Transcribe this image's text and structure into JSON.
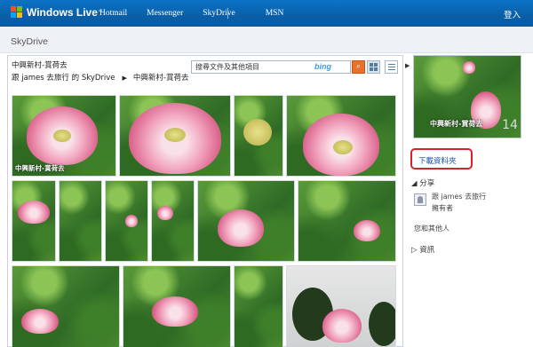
{
  "topbar": {
    "brand": "Windows Live",
    "brand_tm": "™",
    "links": [
      "Hotmail",
      "Messenger",
      "SkyDrive",
      "MSN"
    ],
    "signin": "登入"
  },
  "subheader": {
    "title": "SkyDrive"
  },
  "breadcrumb": {
    "folder": "中興新村-賞荷去",
    "owner_link": "跟 james 去旅行 的 SkyDrive",
    "arrow": "▶",
    "current": "中興新村-賞荷去"
  },
  "search": {
    "placeholder": "搜尋文件及其他項目",
    "engine": "bing",
    "button_icon": "search-icon"
  },
  "view_modes": [
    "thumbnails-view-icon",
    "list-view-icon"
  ],
  "photos": {
    "caption": "中興新村-賞荷去"
  },
  "sidebar": {
    "cover_caption": "中興新村-賞荷去",
    "cover_count": "14",
    "download_link": "下載資料夾",
    "share_heading": "分享",
    "owner_name": "跟 james 去旅行",
    "owner_role": "擁有者",
    "others": "您和其他人",
    "info_heading": "資訊"
  },
  "colors": {
    "topbar": "#0a5fa8",
    "link": "#1553a8",
    "highlight": "#d8222a",
    "search_button": "#e8722a"
  }
}
